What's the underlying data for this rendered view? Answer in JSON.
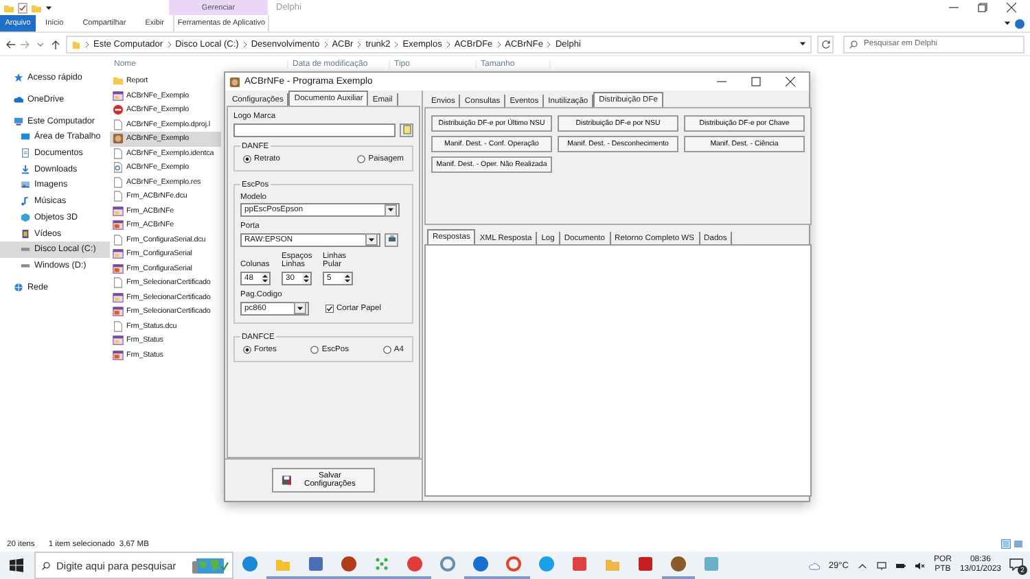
{
  "explorer": {
    "title": "Delphi",
    "context_group": "Gerenciar",
    "ribbon_tabs": [
      {
        "label": "Arquivo",
        "kind": "file"
      },
      {
        "label": "Início",
        "kind": "tab"
      },
      {
        "label": "Compartilhar",
        "kind": "tab"
      },
      {
        "label": "Exibir",
        "kind": "tab"
      },
      {
        "label": "Ferramentas de Aplicativo",
        "kind": "context"
      }
    ],
    "breadcrumb": [
      "Este Computador",
      "Disco Local (C:)",
      "Desenvolvimento",
      "ACBr",
      "trunk2",
      "Exemplos",
      "ACBrDFe",
      "ACBrNFe",
      "Delphi"
    ],
    "search": {
      "placeholder": "Pesquisar em Delphi"
    },
    "columns": [
      "Nome",
      "Data de modificação",
      "Tipo",
      "Tamanho"
    ],
    "sidebar": [
      {
        "label": "Acesso rápido",
        "selected": false
      },
      {
        "label": "OneDrive",
        "selected": false
      },
      {
        "label": "Este Computador",
        "selected": false,
        "children": [
          {
            "label": "Área de Trabalho",
            "selected": false
          },
          {
            "label": "Documentos",
            "selected": false
          },
          {
            "label": "Downloads",
            "selected": false
          },
          {
            "label": "Imagens",
            "selected": false
          },
          {
            "label": "Músicas",
            "selected": false
          },
          {
            "label": "Objetos 3D",
            "selected": false
          },
          {
            "label": "Vídeos",
            "selected": false
          },
          {
            "label": "Disco Local (C:)",
            "selected": true
          },
          {
            "label": "Windows (D:)",
            "selected": false
          }
        ]
      },
      {
        "label": "Rede",
        "selected": false
      }
    ],
    "files": [
      {
        "name": "Report",
        "selected": false
      },
      {
        "name": "ACBrNFe_Exemplo",
        "selected": false
      },
      {
        "name": "ACBrNFe_Exemplo",
        "selected": false
      },
      {
        "name": "ACBrNFe_Exemplo.dproj.l",
        "selected": false
      },
      {
        "name": "ACBrNFe_Exemplo",
        "selected": true
      },
      {
        "name": "ACBrNFe_Exemplo.identca",
        "selected": false
      },
      {
        "name": "ACBrNFe_Exemplo",
        "selected": false
      },
      {
        "name": "ACBrNFe_Exemplo.res",
        "selected": false
      },
      {
        "name": "Frm_ACBrNFe.dcu",
        "selected": false
      },
      {
        "name": "Frm_ACBrNFe",
        "selected": false
      },
      {
        "name": "Frm_ACBrNFe",
        "selected": false
      },
      {
        "name": "Frm_ConfiguraSerial.dcu",
        "selected": false
      },
      {
        "name": "Frm_ConfiguraSerial",
        "selected": false
      },
      {
        "name": "Frm_ConfiguraSerial",
        "selected": false
      },
      {
        "name": "Frm_SelecionarCertificado",
        "selected": false
      },
      {
        "name": "Frm_SelecionarCertificado",
        "selected": false
      },
      {
        "name": "Frm_SelecionarCertificado",
        "selected": false
      },
      {
        "name": "Frm_Status.dcu",
        "selected": false
      },
      {
        "name": "Frm_Status",
        "selected": false
      },
      {
        "name": "Frm_Status",
        "selected": false
      }
    ],
    "status_bar": {
      "count": "20 itens",
      "selection": "1 item selecionado  3,67 MB"
    }
  },
  "app_window": {
    "title": "ACBrNFe - Programa Exemplo",
    "config_tabs": [
      {
        "label": "Configurações",
        "selected": false
      },
      {
        "label": "Documento Auxiliar",
        "selected": true
      },
      {
        "label": "Email",
        "selected": false
      }
    ],
    "logo_label": "Logo Marca",
    "danfe": {
      "title": "DANFE",
      "options": [
        {
          "label": "Retrato",
          "selected": true
        },
        {
          "label": "Paisagem",
          "selected": false
        }
      ]
    },
    "escpos": {
      "title": "EscPos",
      "modelo": {
        "label": "Modelo",
        "value": "ppEscPosEpson"
      },
      "porta": {
        "label": "Porta",
        "value": "RAW:EPSON"
      },
      "spinners": [
        {
          "label": "Colunas",
          "value": "48"
        },
        {
          "label": "Espaços Linhas",
          "value": "30"
        },
        {
          "label": "Linhas Pular",
          "value": "5"
        }
      ],
      "pag_codigo": {
        "label": "Pag.Codigo",
        "value": "pc860"
      },
      "cortar_papel": {
        "label": "Cortar Papel",
        "checked": true
      }
    },
    "danfce": {
      "title": "DANFCE",
      "options": [
        {
          "label": "Fortes",
          "selected": true
        },
        {
          "label": "EscPos",
          "selected": false
        },
        {
          "label": "A4",
          "selected": false
        }
      ]
    },
    "save_button": "Salvar Configurações",
    "service_tabs": [
      {
        "label": "Envios",
        "selected": false
      },
      {
        "label": "Consultas",
        "selected": false
      },
      {
        "label": "Eventos",
        "selected": false
      },
      {
        "label": "Inutilização",
        "selected": false
      },
      {
        "label": "Distribuição DFe",
        "selected": true
      }
    ],
    "actions": [
      "Distribuição DF-e por Último NSU",
      "Distribuição DF-e por NSU",
      "Distribuição DF-e por Chave",
      "Manif. Dest. - Conf. Operação",
      "Manif. Dest. - Desconhecimento",
      "Manif. Dest. - Ciência",
      "Manif. Dest. - Oper. Não Realizada"
    ],
    "response_tabs": [
      {
        "label": "Respostas",
        "selected": true
      },
      {
        "label": "XML Resposta",
        "selected": false
      },
      {
        "label": "Log",
        "selected": false
      },
      {
        "label": "Documento",
        "selected": false
      },
      {
        "label": "Retorno Completo WS",
        "selected": false
      },
      {
        "label": "Dados",
        "selected": false
      }
    ]
  },
  "taskbar": {
    "search": {
      "placeholder": "Digite aqui para pesquisar"
    },
    "apps": [
      {
        "kind": "circle",
        "color": "#1b8ad6",
        "running": false
      },
      {
        "kind": "folder",
        "color": "#f2c12e",
        "running": true
      },
      {
        "kind": "square",
        "color": "#4a6fb5",
        "running": true
      },
      {
        "kind": "circle",
        "color": "#b23a1a",
        "running": true
      },
      {
        "kind": "dots",
        "color": "#3bb54a",
        "running": true
      },
      {
        "kind": "circle",
        "color": "#e03a3a",
        "running": true
      },
      {
        "kind": "ring",
        "color": "#6a8fb5",
        "running": false
      },
      {
        "kind": "circle",
        "color": "#1570d0",
        "running": true
      },
      {
        "kind": "ring",
        "color": "#e0452b",
        "running": true
      },
      {
        "kind": "circle",
        "color": "#1aa0e8",
        "running": false
      },
      {
        "kind": "square",
        "color": "#e04040",
        "running": false
      },
      {
        "kind": "folder",
        "color": "#f0b84a",
        "running": false
      },
      {
        "kind": "square",
        "color": "#c42020",
        "running": false
      },
      {
        "kind": "circle",
        "color": "#8a5a2a",
        "running": true
      },
      {
        "kind": "square",
        "color": "#6ab0c8",
        "running": false
      }
    ],
    "weather": "29°C",
    "language": [
      "POR",
      "PTB"
    ],
    "time": "08:36",
    "date": "13/01/2023",
    "notifications": "2"
  }
}
